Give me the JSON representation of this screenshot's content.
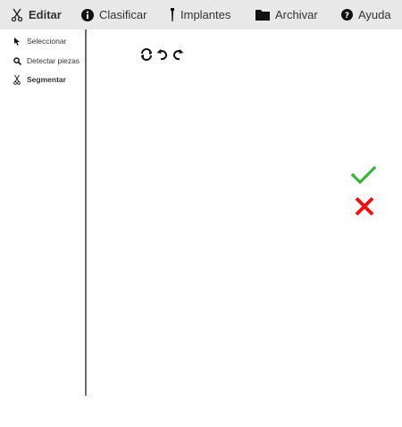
{
  "menu": {
    "items": [
      {
        "label": "Editar",
        "icon": "scissors-icon"
      },
      {
        "label": "Clasificar",
        "icon": "info-icon"
      },
      {
        "label": "Implantes",
        "icon": "implant-icon"
      },
      {
        "label": "Archivar",
        "icon": "folder-icon"
      },
      {
        "label": "Ayuda",
        "icon": "help-icon"
      }
    ]
  },
  "tools": {
    "items": [
      {
        "label": "Seleccionar",
        "icon": "cursor-icon"
      },
      {
        "label": "Detectar piezas",
        "icon": "search-icon"
      },
      {
        "label": "Segmentar",
        "icon": "scissors-icon",
        "selected": true
      }
    ]
  },
  "history": {
    "icons": [
      "refresh-icon",
      "undo-icon",
      "redo-icon"
    ]
  },
  "actions": {
    "confirm_icon": "check-icon",
    "cancel_icon": "close-icon",
    "confirm_color": "#3bb33b",
    "cancel_color": "#ee1111"
  }
}
